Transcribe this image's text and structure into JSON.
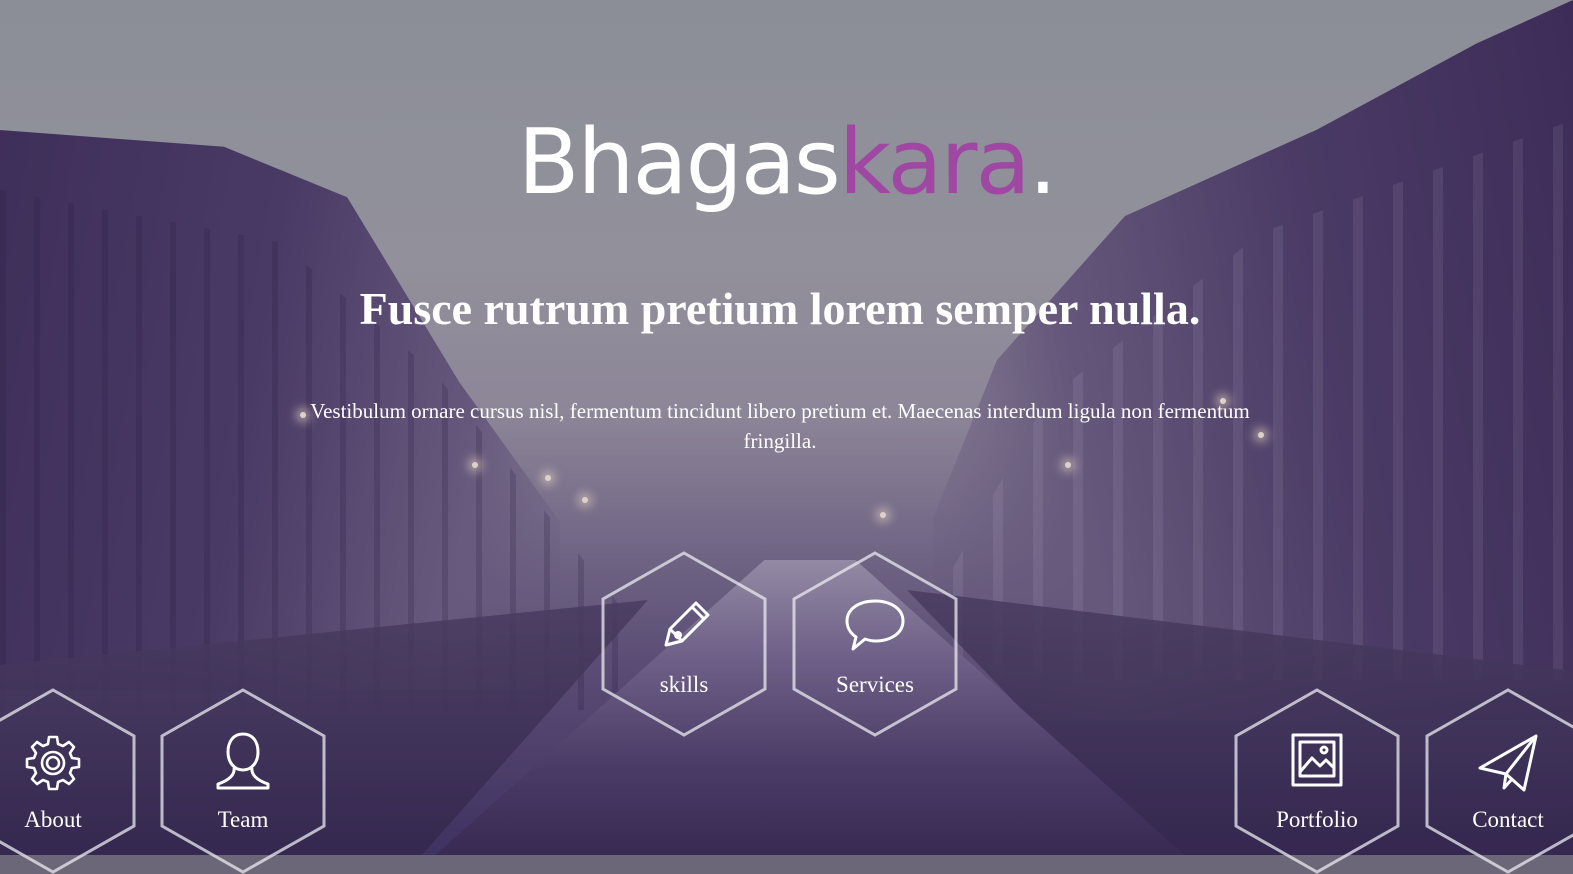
{
  "brand": {
    "part1": "Bhagas",
    "part2": "kara",
    "part3": ".",
    "accent_color": "#a046a3"
  },
  "hero": {
    "headline": "Fusce rutrum pretium lorem semper nulla.",
    "subtext": "Vestibulum ornare cursus nisl, fermentum tincidunt libero pretium et. Maecenas interdum ligula non fermentum fringilla."
  },
  "nav": {
    "skills": {
      "label": "skills",
      "icon": "pencil-icon"
    },
    "services": {
      "label": "Services",
      "icon": "speech-bubble-icon"
    },
    "about": {
      "label": "About",
      "icon": "gear-icon"
    },
    "team": {
      "label": "Team",
      "icon": "person-icon"
    },
    "portfolio": {
      "label": "Portfolio",
      "icon": "image-icon"
    },
    "contact": {
      "label": "Contact",
      "icon": "paper-plane-icon"
    }
  }
}
